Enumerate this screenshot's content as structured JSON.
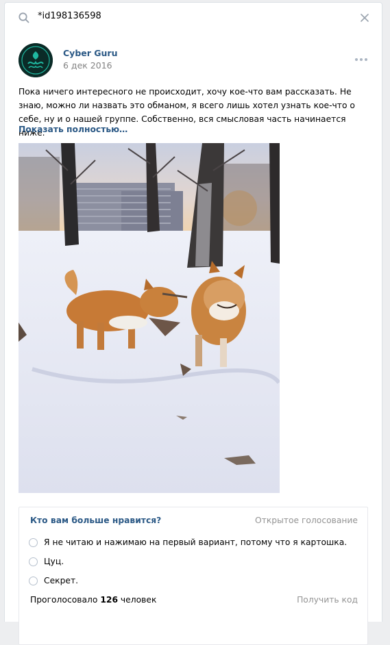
{
  "search": {
    "query": "*id198136598"
  },
  "post": {
    "author": "Cyber Guru",
    "date": "6 дек 2016",
    "text": "Пока ничего интересного не происходит, хочу кое-что вам рассказать. Не знаю, можно ли назвать это обманом, я всего лишь хотел узнать кое-что о себе, ну и о нашей группе. Собственно, вся смысловая часть начинается ниже.",
    "show_more": "Показать полностью…"
  },
  "poll": {
    "title": "Кто вам больше нравится?",
    "type": "Открытое голосование",
    "options": [
      "Я не читаю и нажимаю на первый вариант, потому что я картошка.",
      "Цуц.",
      "Секрет."
    ],
    "voted_prefix": "Проголосовало",
    "voted_count": "126",
    "voted_suffix": "человек",
    "get_code": "Получить код"
  },
  "icons": {
    "search": "search-icon",
    "clear": "close-icon",
    "more": "more-dots-icon",
    "avatar": "cyber-guru-logo"
  },
  "colors": {
    "link": "#2a5885",
    "muted": "#828282",
    "background": "#edeef0",
    "avatar_accent": "#1fb8a0"
  }
}
